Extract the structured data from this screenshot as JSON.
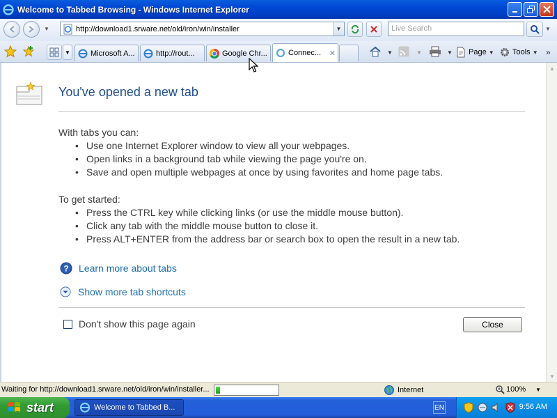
{
  "window": {
    "title": "Welcome to Tabbed Browsing - Windows Internet Explorer"
  },
  "address_bar": {
    "url": "http://download1.srware.net/old/iron/win/installer",
    "search_placeholder": "Live Search"
  },
  "tabs": [
    {
      "label": "Microsoft A...",
      "icon": "ie-page-icon",
      "active": false
    },
    {
      "label": "http://rout...",
      "icon": "ie-page-icon",
      "active": false
    },
    {
      "label": "Google Chr...",
      "icon": "chrome-icon",
      "active": false
    },
    {
      "label": "Connec...",
      "icon": "loading-icon",
      "active": true
    }
  ],
  "command_bar": {
    "page_label": "Page",
    "tools_label": "Tools"
  },
  "page": {
    "heading": "You've opened a new tab",
    "with_tabs_intro": "With tabs you can:",
    "with_tabs_items": [
      "Use one Internet Explorer window to view all your webpages.",
      "Open links in a background tab while viewing the page you're on.",
      "Save and open multiple webpages at once by using favorites and home page tabs."
    ],
    "getting_started_intro": "To get started:",
    "getting_started_items": [
      "Press the CTRL key while clicking links (or use the middle mouse button).",
      "Click any tab with the middle mouse button to close it.",
      "Press ALT+ENTER from the address bar or search box to open the result in a new tab."
    ],
    "learn_more_link": "Learn more about tabs",
    "shortcuts_link": "Show more tab shortcuts",
    "dont_show_label": "Don't show this page again",
    "dont_show_checked": false,
    "close_button": "Close"
  },
  "status_bar": {
    "text": "Waiting for http://download1.srware.net/old/iron/win/installer...",
    "progress_fraction": 0.07,
    "zone": "Internet",
    "zoom": "100%"
  },
  "taskbar": {
    "start_label": "start",
    "task_item": "Welcome to Tabbed B...",
    "language": "EN",
    "clock": "9:56 AM"
  },
  "colors": {
    "titlebar_blue": "#0048d4",
    "heading_blue": "#1f4e8c",
    "link_blue": "#1e6fb0",
    "start_green": "#329a32"
  }
}
